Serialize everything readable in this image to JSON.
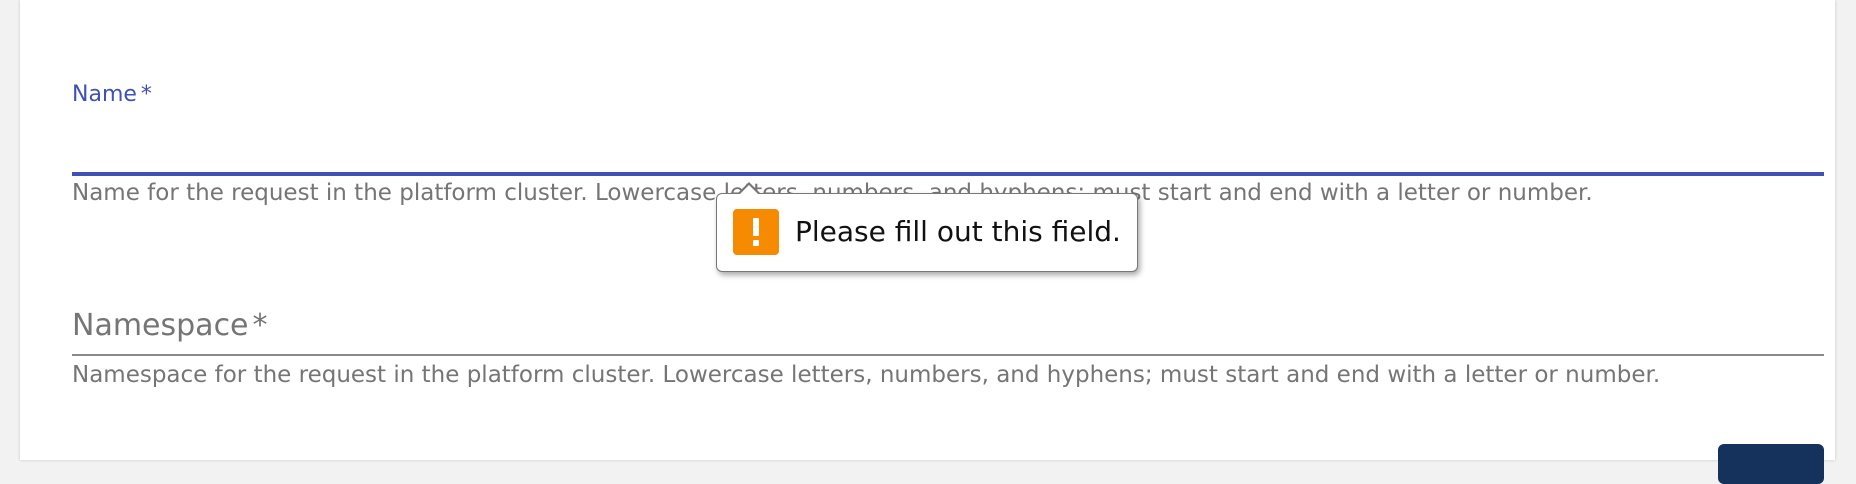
{
  "form": {
    "name_field": {
      "label": "Name",
      "required_marker": "*",
      "value": "",
      "helper": "Name for the request in the platform cluster. Lowercase letters, numbers, and hyphens; must start and end with a letter or number."
    },
    "namespace_field": {
      "label": "Namespace",
      "required_marker": "*",
      "value": "",
      "helper": "Namespace for the request in the platform cluster. Lowercase letters, numbers, and hyphens; must start and end with a letter or number."
    }
  },
  "validation_tooltip": {
    "message": "Please fill out this field.",
    "icon": "warning-icon",
    "icon_color": "#f68a00"
  },
  "colors": {
    "focus_accent": "#3f51b5",
    "helper_text": "#757575",
    "button_bg": "#14325c"
  }
}
